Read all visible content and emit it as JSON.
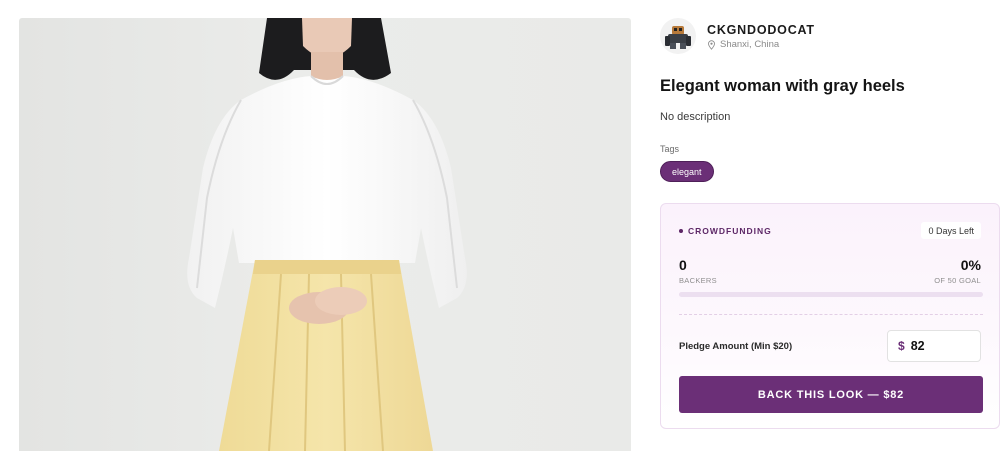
{
  "creator": {
    "name": "CKGNDODOCAT",
    "location": "Shanxi, China",
    "avatar_icon": "mech-robot-avatar",
    "location_icon": "map-pin-icon"
  },
  "look": {
    "title": "Elegant woman with gray heels",
    "description": "No description",
    "image_icon": "model-photo"
  },
  "tags": {
    "heading": "Tags",
    "items": [
      "elegant"
    ]
  },
  "crowdfunding": {
    "label": "CROWDFUNDING",
    "days_left": "0 Days Left",
    "backers_value": "0",
    "backers_label": "BACKERS",
    "percent_value": "0%",
    "goal_label": "OF 50 GOAL",
    "progress_fraction": 0,
    "pledge_label": "Pledge Amount (Min $20)",
    "currency_symbol": "$",
    "pledge_amount": "82",
    "cta_label": "BACK THIS LOOK — $82"
  },
  "colors": {
    "accent": "#6b2f77",
    "card_bg": "#fbf2fc"
  }
}
